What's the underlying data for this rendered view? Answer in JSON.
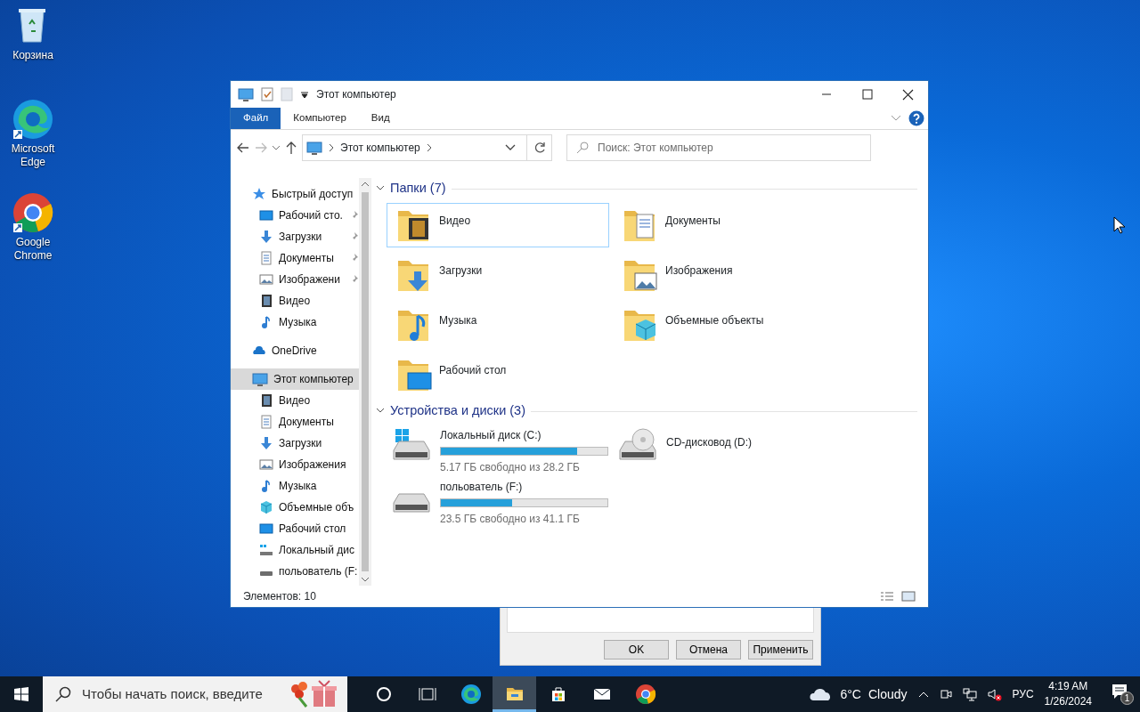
{
  "desktop_icons": [
    {
      "kind": "recycle",
      "label": "Корзина"
    },
    {
      "kind": "edge",
      "label": "Microsoft Edge"
    },
    {
      "kind": "chrome",
      "label": "Google Chrome"
    }
  ],
  "window": {
    "title": "Этот компьютер",
    "ribbon_tabs": [
      {
        "label": "Файл",
        "selected": true
      },
      {
        "label": "Компьютер",
        "selected": false
      },
      {
        "label": "Вид",
        "selected": false
      }
    ],
    "address": {
      "path": "Этот компьютер"
    },
    "search": {
      "placeholder": "Поиск: Этот компьютер"
    },
    "sidebar": [
      {
        "kind": "star",
        "label": "Быстрый доступ",
        "selected": false,
        "children": [
          {
            "kind": "desktop",
            "label": "Рабочий сто.",
            "pinned": true,
            "selected": false
          },
          {
            "kind": "downloads",
            "label": "Загрузки",
            "pinned": true,
            "selected": false
          },
          {
            "kind": "documents",
            "label": "Документы",
            "pinned": true,
            "selected": false
          },
          {
            "kind": "pictures",
            "label": "Изображени",
            "pinned": true,
            "selected": false
          },
          {
            "kind": "video",
            "label": "Видео",
            "pinned": false,
            "selected": false
          },
          {
            "kind": "music",
            "label": "Музыка",
            "pinned": false,
            "selected": false
          }
        ]
      },
      {
        "kind": "onedrive",
        "label": "OneDrive",
        "selected": false
      },
      {
        "kind": "pc",
        "label": "Этот компьютер",
        "selected": true,
        "children": [
          {
            "kind": "video",
            "label": "Видео",
            "pinned": false,
            "selected": false
          },
          {
            "kind": "documents",
            "label": "Документы",
            "pinned": false,
            "selected": false
          },
          {
            "kind": "downloads",
            "label": "Загрузки",
            "pinned": false,
            "selected": false
          },
          {
            "kind": "pictures",
            "label": "Изображения",
            "pinned": false,
            "selected": false
          },
          {
            "kind": "music",
            "label": "Музыка",
            "pinned": false,
            "selected": false
          },
          {
            "kind": "cube",
            "label": "Объемные объ",
            "pinned": false,
            "selected": false
          },
          {
            "kind": "desktop",
            "label": "Рабочий стол",
            "pinned": false,
            "selected": false
          },
          {
            "kind": "localdisk",
            "label": "Локальный дис",
            "pinned": false,
            "selected": false
          },
          {
            "kind": "drive",
            "label": "польователь (F:",
            "pinned": false,
            "selected": false
          }
        ]
      }
    ],
    "folders_section": {
      "title": "Папки (7)",
      "folders": [
        {
          "kind": "video",
          "name": "Видео",
          "selected": true
        },
        {
          "kind": "documents",
          "name": "Документы",
          "selected": false
        },
        {
          "kind": "downloads",
          "name": "Загрузки",
          "selected": false
        },
        {
          "kind": "pictures",
          "name": "Изображения",
          "selected": false
        },
        {
          "kind": "music",
          "name": "Музыка",
          "selected": false
        },
        {
          "kind": "cube",
          "name": "Объемные объекты",
          "selected": false
        },
        {
          "kind": "desktop",
          "name": "Рабочий стол",
          "selected": false
        }
      ]
    },
    "drives_section": {
      "title": "Устройства и диски (3)",
      "drives": [
        {
          "kind": "localdisk",
          "name": "Локальный диск (C:)",
          "level": 0.817,
          "free": "5.17 ГБ свободно из 28.2 ГБ"
        },
        {
          "kind": "cd",
          "name": "CD-дисковод (D:)"
        },
        {
          "kind": "drive",
          "name": "польователь (F:)",
          "level": 0.428,
          "free": "23.5 ГБ свободно из 41.1 ГБ"
        }
      ]
    },
    "status_bar": "Элементов: 10"
  },
  "dialog_behind": {
    "buttons": [
      "OK",
      "Отмена",
      "Применить"
    ]
  },
  "taskbar": {
    "search_placeholder": "Чтобы начать поиск, введите",
    "apps": [
      {
        "kind": "cortana",
        "active": false
      },
      {
        "kind": "taskview",
        "active": false
      },
      {
        "kind": "edge",
        "active": false
      },
      {
        "kind": "explorer",
        "active": true
      },
      {
        "kind": "store",
        "active": false
      },
      {
        "kind": "mail",
        "active": false
      },
      {
        "kind": "chrome",
        "active": false
      }
    ],
    "weather": {
      "temp": "6°C",
      "condition": "Cloudy"
    },
    "language": "РУС",
    "time": "4:19 AM",
    "date": "1/26/2024",
    "notifications": "1"
  }
}
